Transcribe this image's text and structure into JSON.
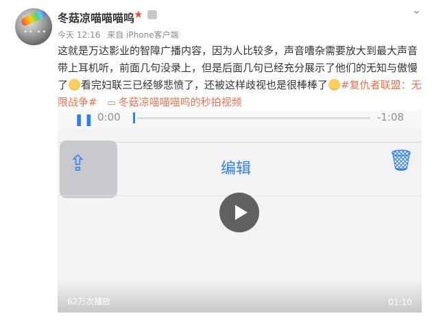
{
  "post": {
    "username": "冬菇凉喵喵喵呜",
    "meta": {
      "time": "今天 12:16",
      "source": "来自 iPhone客户端"
    },
    "content": {
      "line1": "这就是万达影业的智障广播内容，因为人比较多，声音嘈杂需要放大到最大声音",
      "line2": "带上耳机听，前面几句没录上，但是后面几句已经充分展示了他们的无知与傲慢",
      "line3_a": "了",
      "line3_b": "看完妇联三已经够悲愤了，还被这样歧视也是很棒棒了",
      "hashtag_part1": "#复仇者联盟：无",
      "hashtag_part2": "限战争#",
      "video_link": "冬菇凉喵喵喵呜的秒拍视频"
    },
    "emoji": "smile-emoji"
  },
  "video": {
    "audio_time_elapsed": "0:00",
    "audio_time_remaining": "-1:08",
    "edit_label": "编辑",
    "views": "62万次播放",
    "duration": "01:10"
  },
  "colors": {
    "accent_link": "#eb7350",
    "ios_blue": "#2f80f2",
    "star": "#f04a2c"
  },
  "icons": [
    "star-icon",
    "medal-icon",
    "chevron-down-icon",
    "video-camera-icon",
    "share-icon",
    "trash-icon",
    "play-icon",
    "pause-icon"
  ]
}
